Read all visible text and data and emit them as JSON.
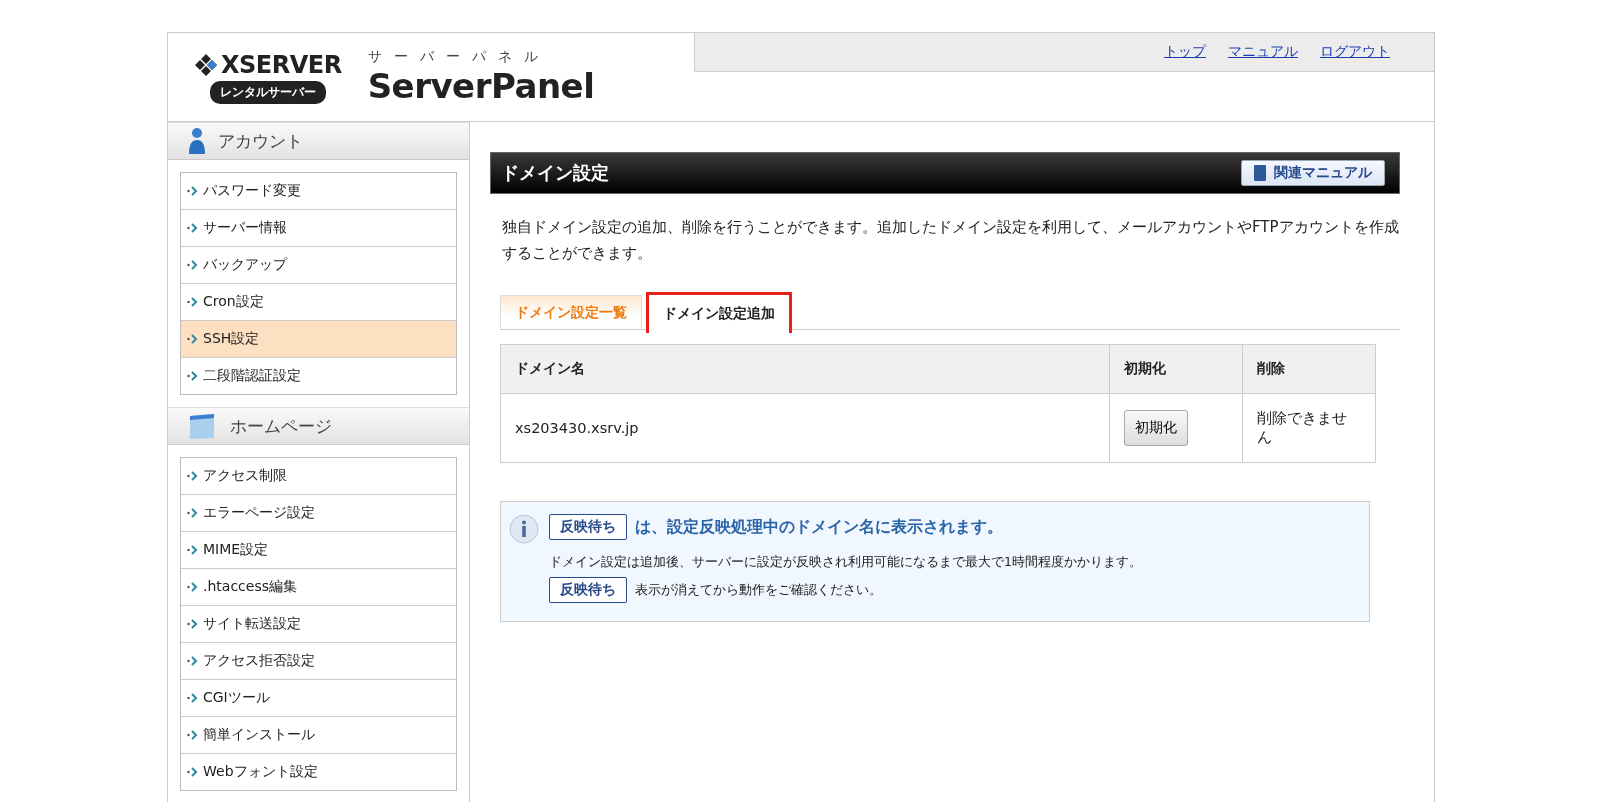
{
  "header": {
    "brand": "XSERVER",
    "brand_badge": "レンタルサーバー",
    "product_kana": "サーバーパネル",
    "product": "ServerPanel",
    "links": [
      "トップ",
      "マニュアル",
      "ログアウト"
    ]
  },
  "sidebar": {
    "sections": [
      {
        "title": "アカウント",
        "kind": "account",
        "items": [
          {
            "label": "パスワード変更",
            "selected": false
          },
          {
            "label": "サーバー情報",
            "selected": false
          },
          {
            "label": "バックアップ",
            "selected": false
          },
          {
            "label": "Cron設定",
            "selected": false
          },
          {
            "label": "SSH設定",
            "selected": true
          },
          {
            "label": "二段階認証設定",
            "selected": false
          }
        ]
      },
      {
        "title": "ホームページ",
        "kind": "homepage",
        "items": [
          {
            "label": "アクセス制限",
            "selected": false
          },
          {
            "label": "エラーページ設定",
            "selected": false
          },
          {
            "label": "MIME設定",
            "selected": false
          },
          {
            "label": ".htaccess編集",
            "selected": false
          },
          {
            "label": "サイト転送設定",
            "selected": false
          },
          {
            "label": "アクセス拒否設定",
            "selected": false
          },
          {
            "label": "CGIツール",
            "selected": false
          },
          {
            "label": "簡単インストール",
            "selected": false
          },
          {
            "label": "Webフォント設定",
            "selected": false
          }
        ]
      }
    ]
  },
  "main": {
    "title": "ドメイン設定",
    "manual_button": "関連マニュアル",
    "description": "独自ドメイン設定の追加、削除を行うことができます。追加したドメイン設定を利用して、メールアカウントやFTPアカウントを作成することができます。",
    "tabs": [
      {
        "label": "ドメイン設定一覧",
        "selected": true,
        "highlighted": false
      },
      {
        "label": "ドメイン設定追加",
        "selected": false,
        "highlighted": true
      }
    ],
    "table": {
      "columns": [
        "ドメイン名",
        "初期化",
        "削除"
      ],
      "rows": [
        {
          "domain": "xs203430.xsrv.jp",
          "reset_button": "初期化",
          "delete": "削除できません"
        }
      ]
    },
    "info": {
      "badge": "反映待ち",
      "headline": "は、設定反映処理中のドメイン名に表示されます。",
      "note": "ドメイン設定は追加後、サーバーに設定が反映され利用可能になるまで最大で1時間程度かかります。",
      "note_badge": "反映待ち",
      "note_tail": "表示が消えてから動作をご確認ください。"
    }
  }
}
